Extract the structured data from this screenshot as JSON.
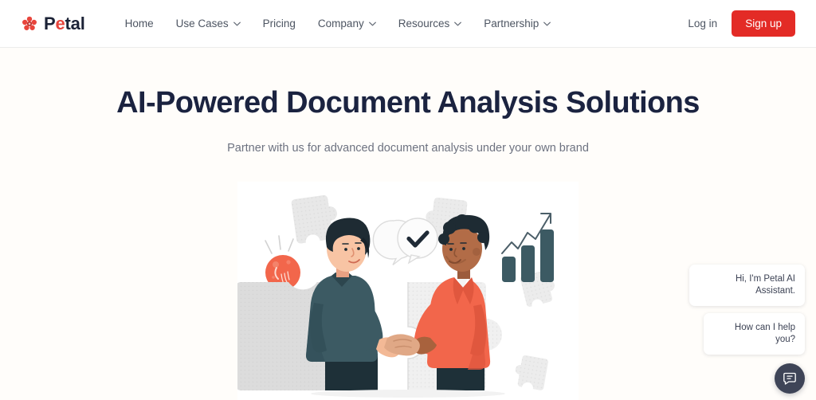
{
  "brand": {
    "name_prefix": "P",
    "name_accent": "e",
    "name_suffix": "tal",
    "full_name": "Petal",
    "logo_color": "#e8453c",
    "text_color": "#1b2236"
  },
  "header": {
    "nav": [
      {
        "label": "Home",
        "has_dropdown": false
      },
      {
        "label": "Use Cases",
        "has_dropdown": true
      },
      {
        "label": "Pricing",
        "has_dropdown": false
      },
      {
        "label": "Company",
        "has_dropdown": true
      },
      {
        "label": "Resources",
        "has_dropdown": true
      },
      {
        "label": "Partnership",
        "has_dropdown": true
      }
    ],
    "login_label": "Log in",
    "signup_label": "Sign up",
    "signup_color": "#e32b26"
  },
  "hero": {
    "title": "AI-Powered Document Analysis Solutions",
    "subtitle": "Partner with us for advanced document analysis under your own brand",
    "illustration_alt": "Two business people shaking hands across interlocking puzzle pieces, with a lightbulb, a checkmark speech bubble and a rising bar chart"
  },
  "chat": {
    "message_1": "Hi, I'm Petal AI Assistant.",
    "message_2": "How can I help you?",
    "fab_color": "#3e4457"
  },
  "colors": {
    "page_background": "#fffdfa",
    "header_background": "#ffffff",
    "heading": "#1b2340",
    "body_text": "#6d7280",
    "accent_red": "#e32b26",
    "illustration_teal": "#3c5a63",
    "illustration_coral": "#f2664b",
    "puzzle_gray": "#dcdcdc"
  }
}
